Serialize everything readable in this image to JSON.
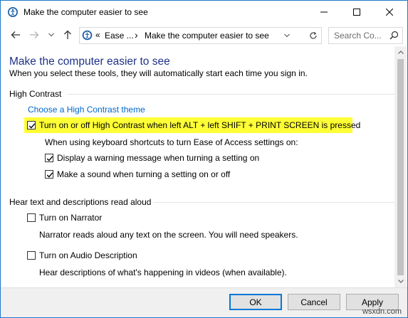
{
  "window": {
    "title": "Make the computer easier to see"
  },
  "address_bar": {
    "crumb_root": "«",
    "crumb_1": "Ease ...",
    "crumb_sep": "›",
    "crumb_2": "Make the computer easier to see"
  },
  "search": {
    "placeholder": "Search Co..."
  },
  "page": {
    "heading": "Make the computer easier to see",
    "subheading": "When you select these tools, they will automatically start each time you sign in."
  },
  "high_contrast": {
    "section_title": "High Contrast",
    "theme_link": "Choose a High Contrast theme",
    "toggle_label": "Turn on or off High Contrast when left ALT + left SHIFT + PRINT SCREEN is pressed",
    "toggle_checked": true,
    "shortcut_note": "When using keyboard shortcuts to turn Ease of Access settings on:",
    "warning_label": "Display a warning message when turning a setting on",
    "warning_checked": true,
    "sound_label": "Make a sound when turning a setting on or off",
    "sound_checked": true
  },
  "narration": {
    "section_title": "Hear text and descriptions read aloud",
    "narrator_label": "Turn on Narrator",
    "narrator_checked": false,
    "narrator_desc": "Narrator reads aloud any text on the screen. You will need speakers.",
    "audio_desc_label": "Turn on Audio Description",
    "audio_desc_checked": false,
    "audio_desc_desc": "Hear descriptions of what's happening in videos (when available)."
  },
  "footer": {
    "ok_label": "OK",
    "cancel_label": "Cancel",
    "apply_label": "Apply"
  },
  "watermark": "wsxdn.com",
  "colors": {
    "heading": "#1e3287",
    "link": "#0066cc",
    "highlight": "#ffff36",
    "window_border": "#1e78c8"
  }
}
